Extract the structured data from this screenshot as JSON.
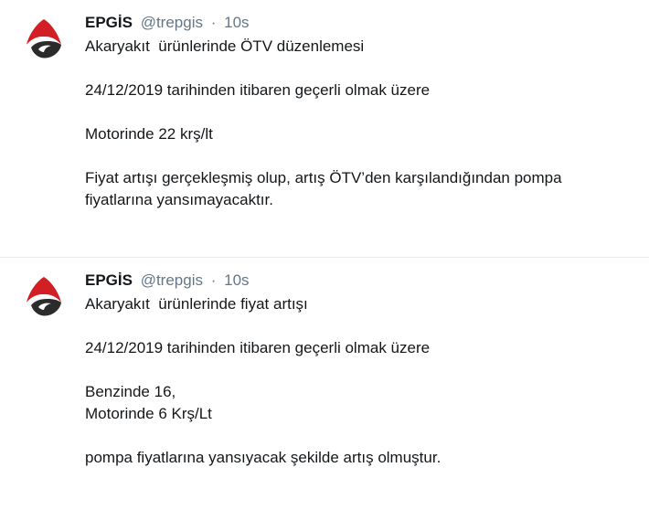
{
  "tweets": [
    {
      "author": {
        "name": "EPGİS",
        "handle": "@trepgis",
        "separator": "·",
        "time": "10s"
      },
      "paragraphs": [
        [
          "Akaryakıt  ürünlerinde ÖTV düzenlemesi"
        ],
        [
          "24/12/2019 tarihinden itibaren geçerli olmak üzere"
        ],
        [
          "Motorinde 22 krş/lt"
        ],
        [
          "Fiyat artışı gerçekleşmiş olup, artış ÖTV’den karşılandığından pompa",
          "fiyatlarına yansımayacaktır."
        ]
      ]
    },
    {
      "author": {
        "name": "EPGİS",
        "handle": "@trepgis",
        "separator": "·",
        "time": "10s"
      },
      "paragraphs": [
        [
          "Akaryakıt  ürünlerinde fiyat artışı"
        ],
        [
          "24/12/2019 tarihinden itibaren geçerli olmak üzere"
        ],
        [
          "Benzinde 16,",
          "Motorinde 6 Krş/Lt"
        ],
        [
          "pompa fiyatlarına yansıyacak şekilde artış olmuştur."
        ]
      ]
    }
  ],
  "colors": {
    "avatar_red": "#d21f26",
    "avatar_dark": "#2b2b2b",
    "muted_text": "#657786",
    "divider": "#e6ecf0"
  },
  "icons": {
    "avatar": "epgis-logo-icon"
  }
}
